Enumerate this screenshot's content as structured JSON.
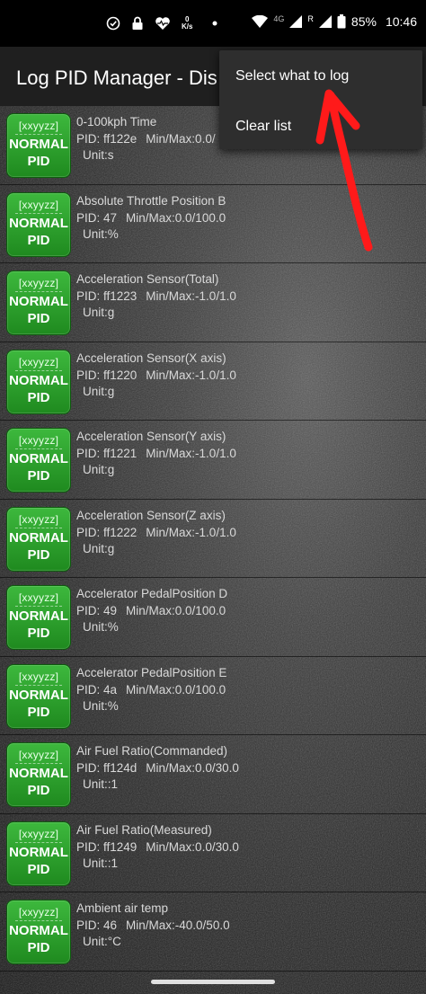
{
  "status_bar": {
    "speed_value": "0",
    "speed_unit": "K/s",
    "network": "4G",
    "roaming": "R",
    "battery": "85%",
    "time": "10:46"
  },
  "toolbar": {
    "title": "Log PID Manager - Dis"
  },
  "menu": {
    "items": [
      "Select what to log",
      "Clear list"
    ]
  },
  "badge": {
    "top": "[xxyyzz]",
    "line1": "NORMAL",
    "line2": "PID"
  },
  "rows": [
    {
      "name": "0-100kph Time",
      "pid": "PID: ff122e",
      "minmax": "Min/Max:0.0/",
      "unit": "Unit:s"
    },
    {
      "name": "Absolute Throttle Position B",
      "pid": "PID: 47",
      "minmax": "Min/Max:0.0/100.0",
      "unit": "Unit:%"
    },
    {
      "name": "Acceleration Sensor(Total)",
      "pid": "PID: ff1223",
      "minmax": "Min/Max:-1.0/1.0",
      "unit": "Unit:g"
    },
    {
      "name": "Acceleration Sensor(X axis)",
      "pid": "PID: ff1220",
      "minmax": "Min/Max:-1.0/1.0",
      "unit": "Unit:g"
    },
    {
      "name": "Acceleration Sensor(Y axis)",
      "pid": "PID: ff1221",
      "minmax": "Min/Max:-1.0/1.0",
      "unit": "Unit:g"
    },
    {
      "name": "Acceleration Sensor(Z axis)",
      "pid": "PID: ff1222",
      "minmax": "Min/Max:-1.0/1.0",
      "unit": "Unit:g"
    },
    {
      "name": "Accelerator PedalPosition D",
      "pid": "PID: 49",
      "minmax": "Min/Max:0.0/100.0",
      "unit": "Unit:%"
    },
    {
      "name": "Accelerator PedalPosition E",
      "pid": "PID: 4a",
      "minmax": "Min/Max:0.0/100.0",
      "unit": "Unit:%"
    },
    {
      "name": "Air Fuel Ratio(Commanded)",
      "pid": "PID: ff124d",
      "minmax": "Min/Max:0.0/30.0",
      "unit": "Unit::1"
    },
    {
      "name": "Air Fuel Ratio(Measured)",
      "pid": "PID: ff1249",
      "minmax": "Min/Max:0.0/30.0",
      "unit": "Unit::1"
    },
    {
      "name": "Ambient air temp",
      "pid": "PID: 46",
      "minmax": "Min/Max:-40.0/50.0",
      "unit": "Unit:°C"
    }
  ],
  "colors": {
    "badge_green": "#2ea52e",
    "annotation_red": "#ff1a1a",
    "menu_bg": "#2e2e2e"
  }
}
